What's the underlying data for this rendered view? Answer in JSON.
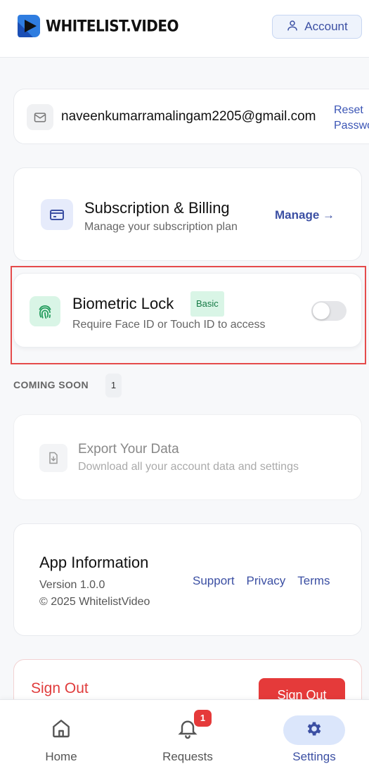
{
  "header": {
    "brand": "WHITELIST.VIDEO",
    "account_label": "Account"
  },
  "email_card": {
    "email": "naveenkumarramalingam2205@gmail.com",
    "reset_line1": "Reset",
    "reset_line2": "Password"
  },
  "subscription": {
    "title": "Subscription & Billing",
    "description": "Manage your subscription plan",
    "manage_label": "Manage →"
  },
  "biometric": {
    "title": "Biometric Lock",
    "badge": "Basic",
    "description": "Require Face ID or Touch ID to access",
    "enabled": false
  },
  "coming_soon": {
    "label": "COMING SOON",
    "count": "1"
  },
  "export": {
    "title": "Export Your Data",
    "description": "Download all your account data and settings"
  },
  "app_info": {
    "title": "App Information",
    "version": "Version 1.0.0",
    "copyright": "© 2025 WhitelistVideo",
    "links": [
      "Support",
      "Privacy",
      "Terms"
    ]
  },
  "sign_out": {
    "title": "Sign Out",
    "button_label": "Sign Out"
  },
  "bottom_nav": {
    "home": "Home",
    "requests": "Requests",
    "requests_badge": "1",
    "settings": "Settings"
  },
  "colors": {
    "accent": "#3b4fa3",
    "danger": "#e53a3a",
    "success_bg": "#d9f5e6",
    "highlight": "#e54b4b"
  },
  "icons": {
    "account": "user-icon",
    "email": "mail-icon",
    "subscription": "credit-card-icon",
    "biometric": "fingerprint-icon",
    "export": "download-file-icon",
    "home": "home-icon",
    "requests": "bell-icon",
    "settings": "gear-icon"
  }
}
